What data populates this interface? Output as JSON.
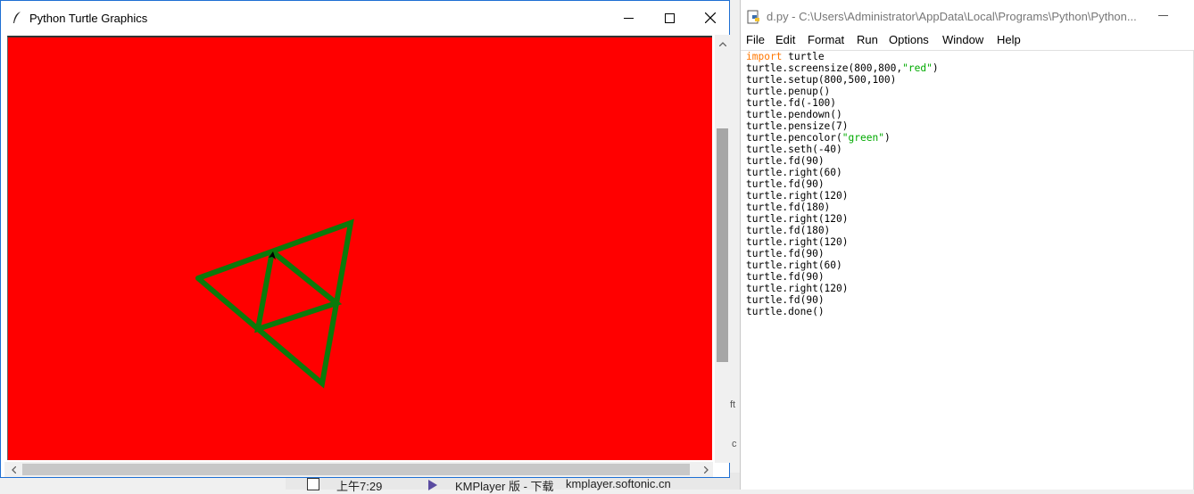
{
  "background": {
    "time": "上午7:29",
    "kmplayer_text": "KMPlayer 版 - 下载",
    "site_text": "kmplayer.softonic.cn",
    "edge_text_1": "ft",
    "edge_text_2": "c"
  },
  "turtle_window": {
    "title": "Python Turtle Graphics",
    "canvas_color": "#ff0000",
    "pen_color": "#008000",
    "pen_size": 7
  },
  "idle_window": {
    "title": "d.py - C:\\Users\\Administrator\\AppData\\Local\\Programs\\Python\\Python...",
    "menu": [
      "File",
      "Edit",
      "Format",
      "Run",
      "Options",
      "Window",
      "Help"
    ],
    "code_lines": [
      "import turtle",
      "turtle.screensize(800,800,\"red\")",
      "turtle.setup(800,500,100)",
      "turtle.penup()",
      "turtle.fd(-100)",
      "turtle.pendown()",
      "turtle.pensize(7)",
      "turtle.pencolor(\"green\")",
      "turtle.seth(-40)",
      "turtle.fd(90)",
      "turtle.right(60)",
      "turtle.fd(90)",
      "turtle.right(120)",
      "turtle.fd(180)",
      "turtle.right(120)",
      "turtle.fd(180)",
      "turtle.right(120)",
      "turtle.fd(90)",
      "turtle.right(60)",
      "turtle.fd(90)",
      "turtle.right(120)",
      "turtle.fd(90)",
      "turtle.done()"
    ]
  }
}
